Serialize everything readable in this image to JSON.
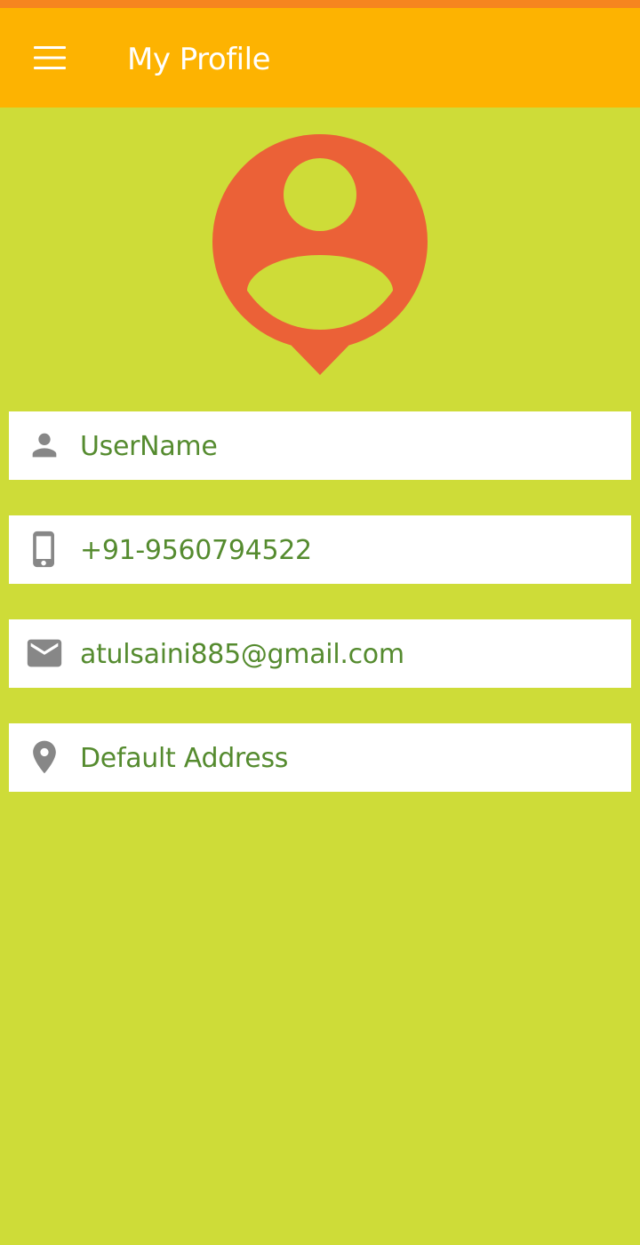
{
  "colors": {
    "status_bar": "#F6851F",
    "app_bar": "#FDB301",
    "background": "#CEDC38",
    "avatar": "#EB6137",
    "field_background": "#FFFFFF",
    "field_text": "#558B2F",
    "field_icon": "#878787",
    "title_text": "#FFFFFF"
  },
  "app_bar": {
    "menu_icon": "menu-icon",
    "title": "My Profile"
  },
  "avatar": {
    "icon": "user-pin-icon"
  },
  "profile": {
    "fields": [
      {
        "icon": "person-icon",
        "value": "UserName"
      },
      {
        "icon": "phone-icon",
        "value": "+91-9560794522"
      },
      {
        "icon": "email-icon",
        "value": "atulsaini885@gmail.com"
      },
      {
        "icon": "location-pin-icon",
        "value": "Default Address"
      }
    ]
  }
}
